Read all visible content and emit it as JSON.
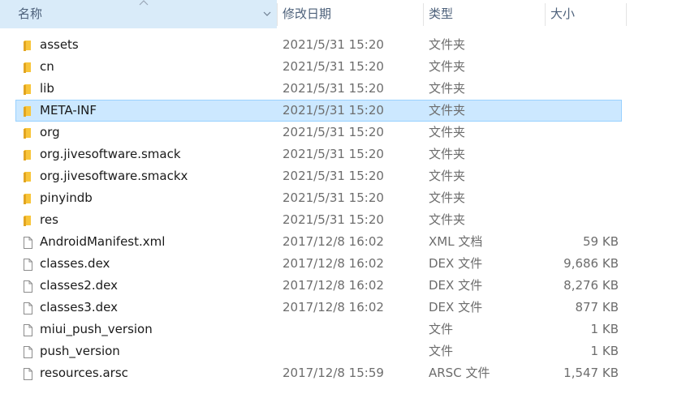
{
  "header": {
    "name_label": "名称",
    "date_label": "修改日期",
    "type_label": "类型",
    "size_label": "大小"
  },
  "colors": {
    "header_active": "#d9ebf9",
    "selected_row": "#cce8ff",
    "selected_border": "#99d1ff",
    "folder": "#f8c53a",
    "header_text": "#4c607a"
  },
  "files": [
    {
      "name": "assets",
      "date": "2021/5/31 15:20",
      "type": "文件夹",
      "size": "",
      "icon": "folder-icon",
      "selected": false
    },
    {
      "name": "cn",
      "date": "2021/5/31 15:20",
      "type": "文件夹",
      "size": "",
      "icon": "folder-icon",
      "selected": false
    },
    {
      "name": "lib",
      "date": "2021/5/31 15:20",
      "type": "文件夹",
      "size": "",
      "icon": "folder-icon",
      "selected": false
    },
    {
      "name": "META-INF",
      "date": "2021/5/31 15:20",
      "type": "文件夹",
      "size": "",
      "icon": "folder-icon",
      "selected": true
    },
    {
      "name": "org",
      "date": "2021/5/31 15:20",
      "type": "文件夹",
      "size": "",
      "icon": "folder-icon",
      "selected": false
    },
    {
      "name": "org.jivesoftware.smack",
      "date": "2021/5/31 15:20",
      "type": "文件夹",
      "size": "",
      "icon": "folder-icon",
      "selected": false
    },
    {
      "name": "org.jivesoftware.smackx",
      "date": "2021/5/31 15:20",
      "type": "文件夹",
      "size": "",
      "icon": "folder-icon",
      "selected": false
    },
    {
      "name": "pinyindb",
      "date": "2021/5/31 15:20",
      "type": "文件夹",
      "size": "",
      "icon": "folder-icon",
      "selected": false
    },
    {
      "name": "res",
      "date": "2021/5/31 15:20",
      "type": "文件夹",
      "size": "",
      "icon": "folder-icon",
      "selected": false
    },
    {
      "name": "AndroidManifest.xml",
      "date": "2017/12/8 16:02",
      "type": "XML 文档",
      "size": "59 KB",
      "icon": "file-icon",
      "selected": false
    },
    {
      "name": "classes.dex",
      "date": "2017/12/8 16:02",
      "type": "DEX 文件",
      "size": "9,686 KB",
      "icon": "file-icon",
      "selected": false
    },
    {
      "name": "classes2.dex",
      "date": "2017/12/8 16:02",
      "type": "DEX 文件",
      "size": "8,276 KB",
      "icon": "file-icon",
      "selected": false
    },
    {
      "name": "classes3.dex",
      "date": "2017/12/8 16:02",
      "type": "DEX 文件",
      "size": "877 KB",
      "icon": "file-icon",
      "selected": false
    },
    {
      "name": "miui_push_version",
      "date": "",
      "type": "文件",
      "size": "1 KB",
      "icon": "file-icon",
      "selected": false
    },
    {
      "name": "push_version",
      "date": "",
      "type": "文件",
      "size": "1 KB",
      "icon": "file-icon",
      "selected": false
    },
    {
      "name": "resources.arsc",
      "date": "2017/12/8 15:59",
      "type": "ARSC 文件",
      "size": "1,547 KB",
      "icon": "file-icon",
      "selected": false
    }
  ]
}
